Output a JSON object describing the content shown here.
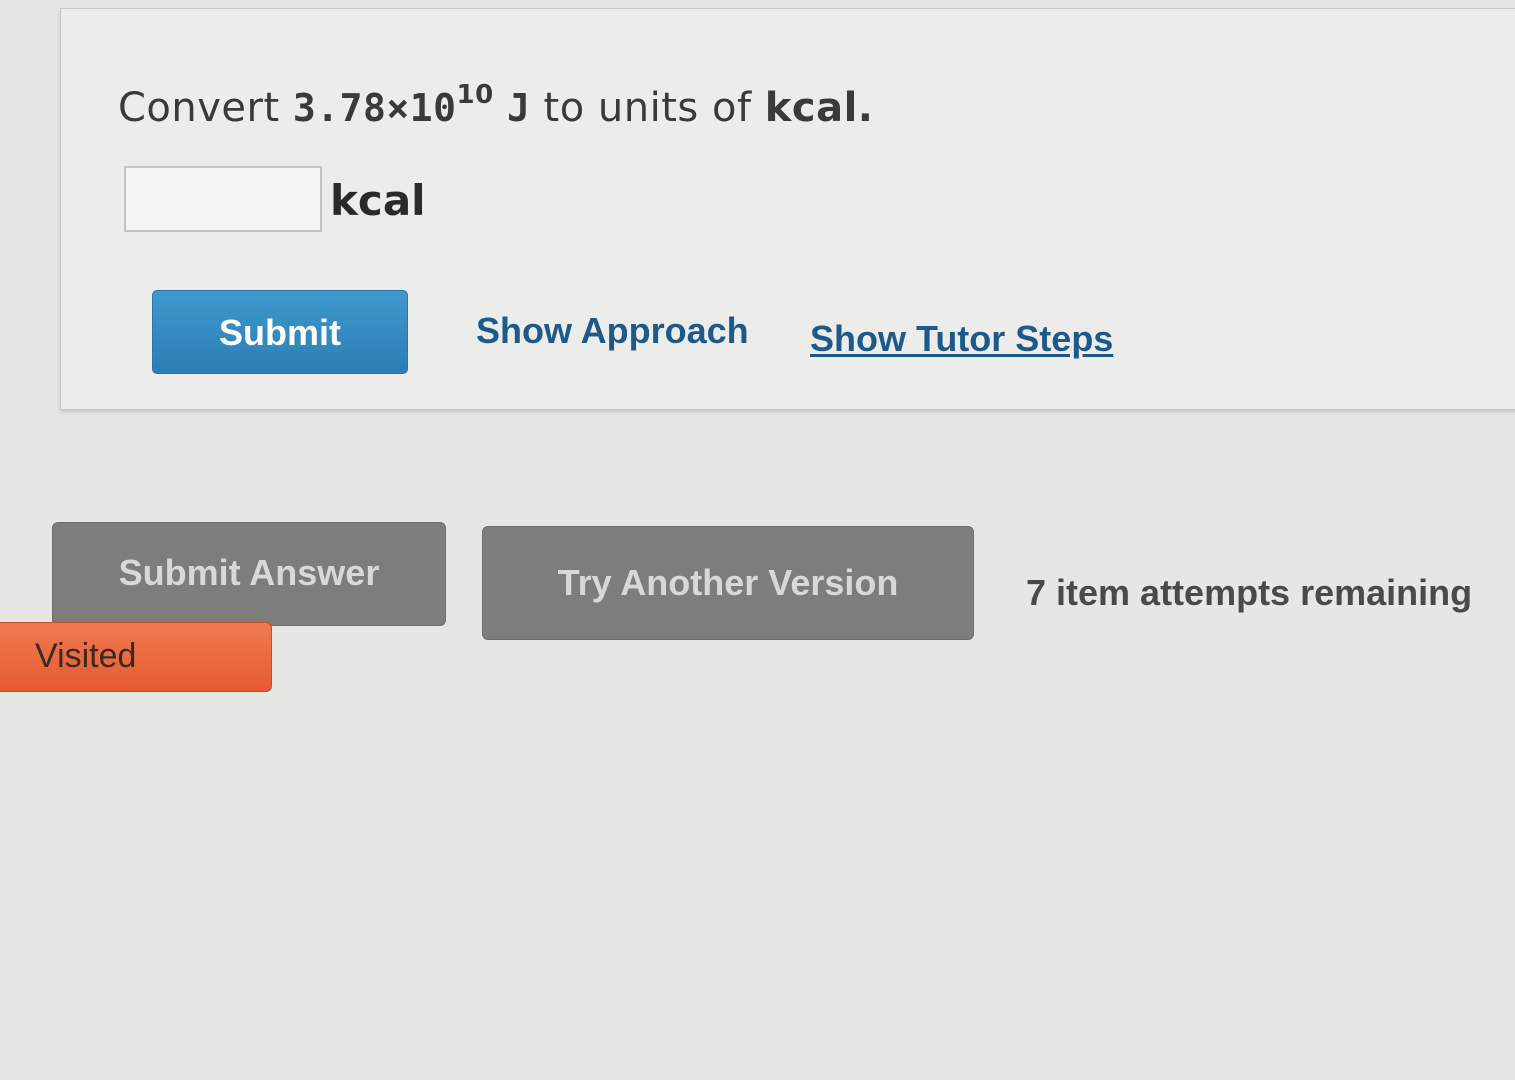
{
  "question": {
    "prefix": "Convert ",
    "value_mantissa": "3.78×10",
    "value_exponent": "10",
    "from_unit": "J",
    "middle": " to units of ",
    "target_unit": "kcal",
    "suffix": "."
  },
  "answer": {
    "value": "",
    "unit": "kcal"
  },
  "actions": {
    "submit_label": "Submit",
    "show_approach_label": "Show Approach",
    "show_tutor_steps_label": "Show Tutor Steps"
  },
  "footer": {
    "submit_answer_label": "Submit Answer",
    "try_another_label": "Try Another Version",
    "attempts_text": "7 item attempts remaining",
    "visited_label": "Visited"
  },
  "colors": {
    "submit_blue": "#2b7fb5",
    "link_blue": "#1d5a8a",
    "visited_orange": "#e65a32",
    "disabled_gray": "#7d7d7c"
  }
}
